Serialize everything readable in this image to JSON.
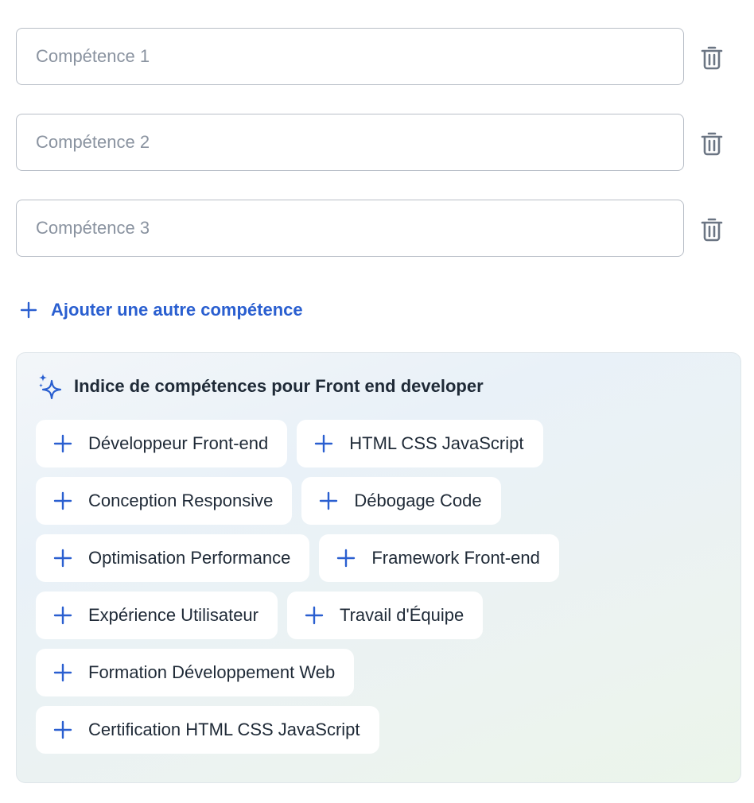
{
  "skills": [
    {
      "placeholder": "Compétence 1",
      "value": ""
    },
    {
      "placeholder": "Compétence 2",
      "value": ""
    },
    {
      "placeholder": "Compétence 3",
      "value": ""
    }
  ],
  "add_skill_label": "Ajouter une autre compétence",
  "suggestions": {
    "title": "Indice de compétences pour Front end developer",
    "chips": [
      "Développeur Front-end",
      "HTML CSS JavaScript",
      "Conception Responsive",
      "Débogage Code",
      "Optimisation Performance",
      "Framework Front-end",
      "Expérience Utilisateur",
      "Travail d'Équipe",
      "Formation Développement Web",
      "Certification HTML CSS JavaScript"
    ]
  },
  "colors": {
    "accent": "#2a5fd0",
    "text": "#1f2a37",
    "placeholder": "#8a93a0",
    "icon": "#6b7583"
  },
  "icons": {
    "delete": "trash-icon",
    "add": "plus-icon",
    "sparkle": "sparkle-icon"
  }
}
